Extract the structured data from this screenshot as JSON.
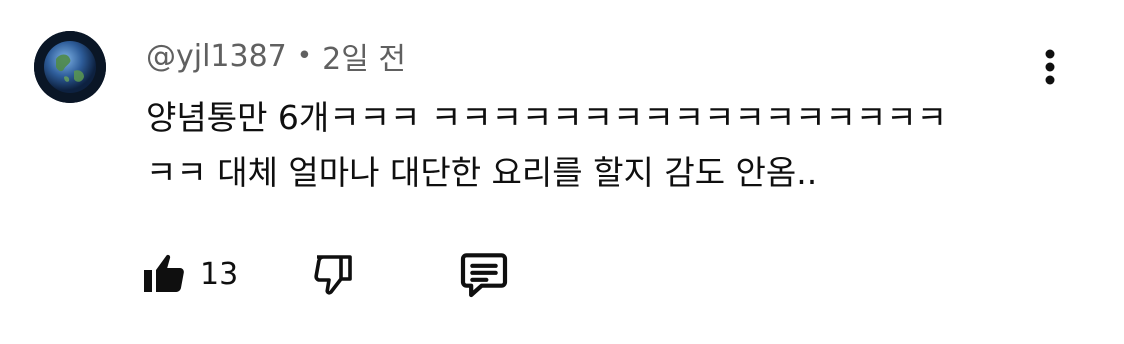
{
  "comment": {
    "author": "@yjl1387",
    "separator": "•",
    "time": "2일 전",
    "text_line1": "양념통만 6개ㅋㅋㅋ ㅋㅋㅋㅋㅋㅋㅋㅋㅋㅋㅋㅋㅋㅋㅋㅋㅋ",
    "text_line2": "ㅋㅋ 대체 얼마나 대단한 요리를 할지 감도 안옴..",
    "like_count": "13"
  },
  "icons": {
    "avatar": "earth-globe-avatar",
    "menu": "more-vertical-icon",
    "like": "thumbs-up-filled-icon",
    "dislike": "thumbs-down-outline-icon",
    "reply": "comment-reply-icon"
  },
  "colors": {
    "text": "#0f0f0f",
    "meta": "#606060",
    "background": "#ffffff"
  }
}
